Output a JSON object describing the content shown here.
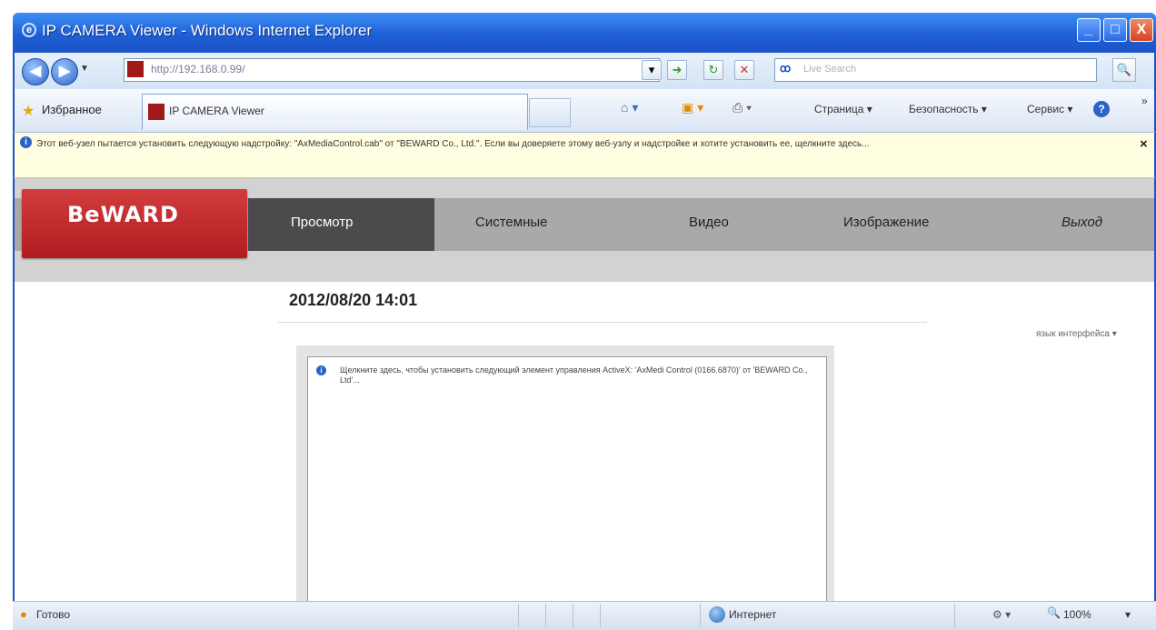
{
  "window": {
    "title": "IP CAMERA Viewer - Windows Internet Explorer",
    "minimize": "_",
    "maximize": "□",
    "close": "X"
  },
  "address_bar": {
    "url": "http://192.168.0.99/",
    "search_placeholder": "Live Search",
    "search_logo": "ꝏ"
  },
  "toolbar": {
    "favorites_label": "Избранное",
    "tab_title": "IP CAMERA Viewer",
    "commands": [
      "Страница ▾",
      "Безопасность ▾",
      "Сервис ▾"
    ],
    "help": "?"
  },
  "infobar": {
    "text": "Этот веб-узел пытается установить следующую надстройку: \"AxMediaControl.cab\" от \"BEWARD Co., Ltd.\". Если вы доверяете этому веб-узлу и надстройке и хотите установить ее, щелкните здесь...",
    "close": "×"
  },
  "camera_page": {
    "logo": "BeWARD",
    "logo_sub": "",
    "nav": [
      "Просмотр",
      "Системные",
      "Видео",
      "Изображение",
      "Выход"
    ],
    "datetime": "2012/08/20 14:01",
    "side_link": "язык интерфейса ▾",
    "activex_prompt": "Щелкните здесь, чтобы установить следующий элемент управления ActiveX: 'AxMedi Control (0166.6870)' от 'BEWARD Co., Ltd'..."
  },
  "statusbar": {
    "status": "Готово",
    "zone": "Интернет",
    "zoom": "100%",
    "zoom_arrow": "▾"
  },
  "colors": {
    "titlebar": "#1f5fd6",
    "logo_red": "#c42a2e",
    "nav_active": "#4d4a4d",
    "nav_strip": "#a9a9a9"
  }
}
